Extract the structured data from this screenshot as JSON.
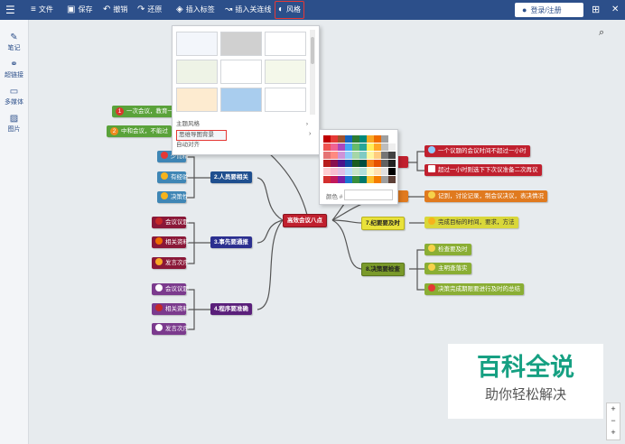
{
  "toolbar": {
    "menu_icon": "hamburger-icon",
    "file": "文件",
    "save": "保存",
    "undo": "撤销",
    "redo": "还原",
    "insert_tag": "插入标签",
    "insert_link": "插入关连线",
    "style": "风格",
    "login": "登录/注册"
  },
  "sidebar": {
    "notes": "笔记",
    "hyperlink": "超链接",
    "media": "多媒体",
    "image": "图片"
  },
  "style_menu": {
    "theme_style": "主题风格",
    "map_background": "思维导图背景",
    "auto_align": "自动对齐"
  },
  "palette": {
    "color_label": "颜色 #",
    "colors": [
      "#c00000",
      "#e53935",
      "#a0522d",
      "#1565c0",
      "#2e7d32",
      "#00897b",
      "#f9a825",
      "#ef6c00",
      "#9e9e9e",
      "#ffffff",
      "#ef5350",
      "#f06292",
      "#ab47bc",
      "#42a5f5",
      "#66bb6a",
      "#26a69a",
      "#ffee58",
      "#ffa726",
      "#bdbdbd",
      "#eeeeee",
      "#e57373",
      "#ff8a80",
      "#ce93d8",
      "#90caf9",
      "#a5d6a7",
      "#80cbc4",
      "#fff59d",
      "#ffcc80",
      "#757575",
      "#424242",
      "#b71c1c",
      "#880e4f",
      "#4a148c",
      "#0d47a1",
      "#1b5e20",
      "#004d40",
      "#f57f17",
      "#e65100",
      "#616161",
      "#212121",
      "#ffcdd2",
      "#f8bbd0",
      "#e1bee7",
      "#bbdefb",
      "#c8e6c9",
      "#b2dfdb",
      "#fff9c4",
      "#ffe0b2",
      "#e0e0e0",
      "#000000",
      "#d32f2f",
      "#c2185b",
      "#7b1fa2",
      "#1976d2",
      "#388e3c",
      "#00796b",
      "#fbc02d",
      "#f57c00",
      "#9e9e9e",
      "#5d4037"
    ]
  },
  "mindmap": {
    "center": "高效会议八点",
    "branch2": "2.人员要相关",
    "branch2_items": [
      "少而精",
      "有经验",
      "决策性"
    ],
    "branch3": "3.事先要通报",
    "branch3_items": [
      "会议议题",
      "相关资料",
      "发言次序"
    ],
    "branch4": "4.程序要准确",
    "branch4_items": [
      "会议议题",
      "相关资料",
      "发言次序"
    ],
    "branch7": "7.纪要要及时",
    "branch7_item": "完成目标的时间，要求，方法",
    "branch8": "8.决策要检查",
    "branch8_items": [
      "检查要及时",
      "主明查落实",
      "决策完成期限要进行及时的总结"
    ],
    "right_items": [
      "一个议题的会议时间不超过一小时",
      "超过一小时则选下下次议准备二次再议",
      "记到，讨论记录，制会议决议，表决情况"
    ],
    "left_items": [
      "一次会议，教育一",
      "中和会议，不能过"
    ],
    "left_nums": [
      "1",
      "2"
    ]
  },
  "watermark": {
    "title": "百科全说",
    "subtitle": "助你轻松解决"
  },
  "zoom": {
    "plus": "+",
    "minus": "−",
    "fit": "+"
  }
}
